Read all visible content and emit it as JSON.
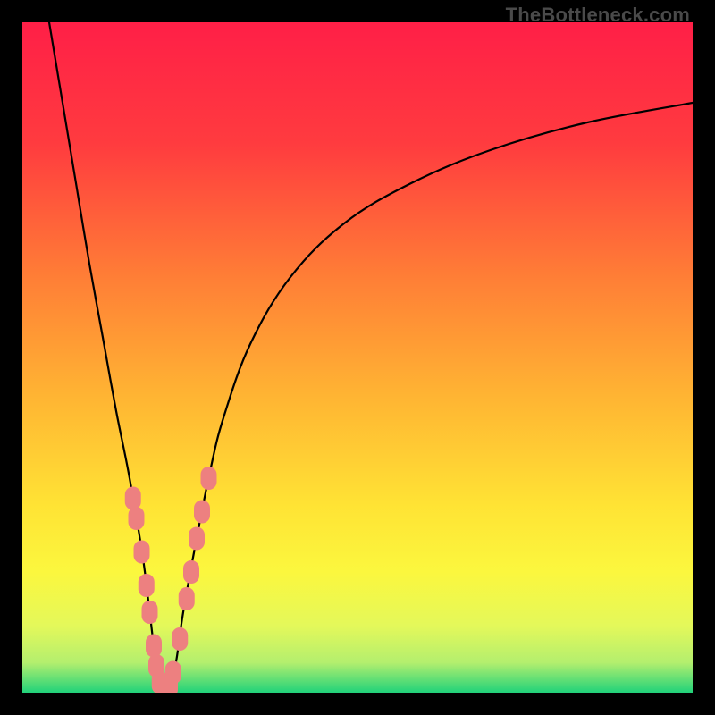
{
  "watermark": "TheBottleneck.com",
  "colors": {
    "gradient_stops": [
      {
        "offset": 0.0,
        "color": "#ff1f47"
      },
      {
        "offset": 0.18,
        "color": "#ff3b3f"
      },
      {
        "offset": 0.38,
        "color": "#ff7e36"
      },
      {
        "offset": 0.55,
        "color": "#ffb233"
      },
      {
        "offset": 0.72,
        "color": "#ffe334"
      },
      {
        "offset": 0.82,
        "color": "#fbf73e"
      },
      {
        "offset": 0.9,
        "color": "#e4f85a"
      },
      {
        "offset": 0.955,
        "color": "#b4ef6e"
      },
      {
        "offset": 1.0,
        "color": "#21d27a"
      }
    ],
    "curve": "#000000",
    "marker": "#ed8080",
    "frame": "#000000"
  },
  "chart_data": {
    "type": "line",
    "title": "",
    "xlabel": "",
    "ylabel": "",
    "xlim": [
      0,
      100
    ],
    "ylim": [
      0,
      100
    ],
    "grid": false,
    "legend": false,
    "series": [
      {
        "name": "bottleneck-curve",
        "x": [
          4,
          6,
          8,
          10,
          12,
          14,
          16,
          18,
          19,
          20,
          21,
          22,
          23,
          24,
          26,
          28,
          30,
          34,
          40,
          48,
          58,
          70,
          84,
          100
        ],
        "y": [
          100,
          88,
          76,
          64,
          53,
          42,
          32,
          20,
          12,
          4,
          0,
          0,
          5,
          12,
          23,
          33,
          41,
          52,
          62,
          70,
          76,
          81,
          85,
          88
        ]
      }
    ],
    "markers": {
      "name": "highlighted-points",
      "points": [
        {
          "x": 16.5,
          "y": 29
        },
        {
          "x": 17.0,
          "y": 26
        },
        {
          "x": 17.8,
          "y": 21
        },
        {
          "x": 18.5,
          "y": 16
        },
        {
          "x": 19.0,
          "y": 12
        },
        {
          "x": 19.6,
          "y": 7
        },
        {
          "x": 20.0,
          "y": 4
        },
        {
          "x": 20.5,
          "y": 1.5
        },
        {
          "x": 21.0,
          "y": 0.5
        },
        {
          "x": 21.5,
          "y": 0.5
        },
        {
          "x": 22.0,
          "y": 1
        },
        {
          "x": 22.5,
          "y": 3
        },
        {
          "x": 23.5,
          "y": 8
        },
        {
          "x": 24.5,
          "y": 14
        },
        {
          "x": 25.2,
          "y": 18
        },
        {
          "x": 26.0,
          "y": 23
        },
        {
          "x": 26.8,
          "y": 27
        },
        {
          "x": 27.8,
          "y": 32
        }
      ]
    }
  }
}
